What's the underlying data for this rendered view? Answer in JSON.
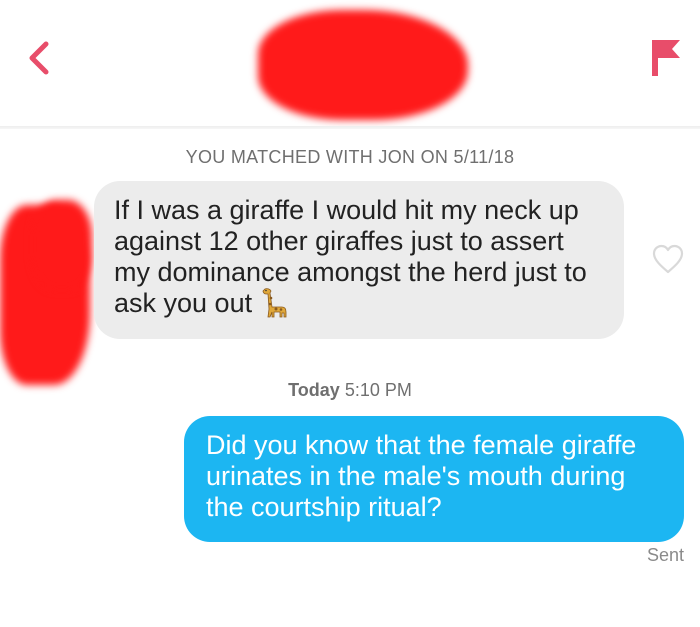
{
  "header": {
    "back_icon": "chevron-left-icon",
    "report_icon": "flag-icon",
    "accent_color": "#e84d6a"
  },
  "conversation": {
    "match_notice": "YOU MATCHED WITH JON ON 5/11/18",
    "incoming_message": {
      "text": "If I was a giraffe I would hit my neck up against 12 other giraffes just to assert my dominance amongst the herd just to ask you out",
      "emoji": "giraffe-icon",
      "bubble_color": "#ececec"
    },
    "like_icon": "heart-outline-icon",
    "timestamp": {
      "day": "Today",
      "time": "5:10 PM"
    },
    "outgoing_message": {
      "text": "Did you know that the female giraffe urinates in the male's mouth during the courtship ritual?",
      "bubble_color": "#1cb6f2"
    },
    "delivery_status": "Sent"
  }
}
